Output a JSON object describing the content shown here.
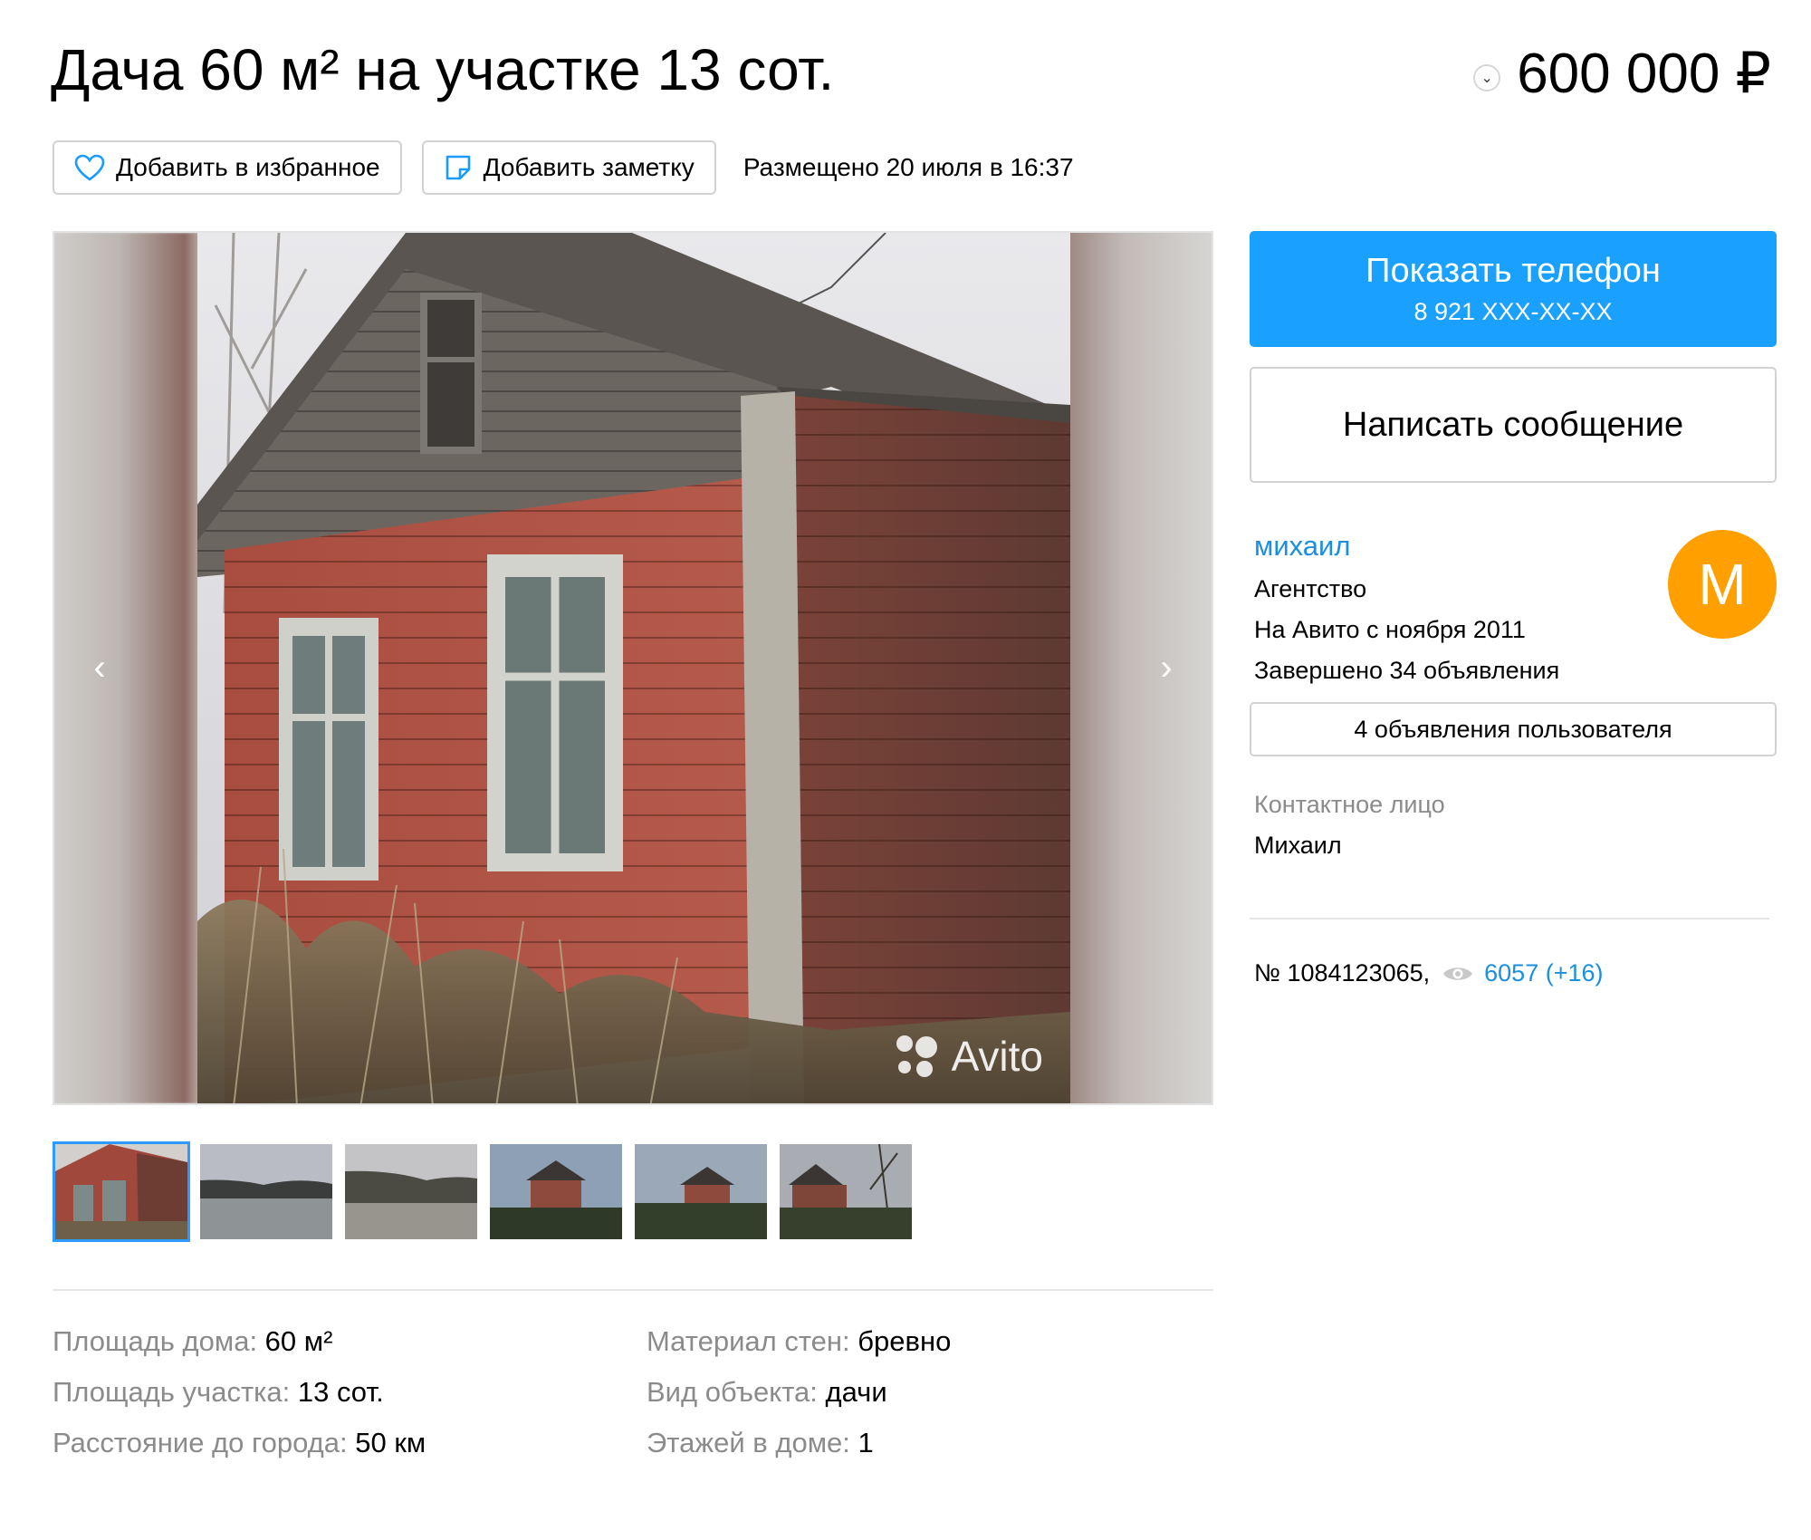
{
  "listing": {
    "title": "Дача 60 м² на участке 13 сот.",
    "price": "600 000 ₽",
    "posted": "Размещено 20 июля в 16:37"
  },
  "actions": {
    "favorite_label": "Добавить в избранное",
    "note_label": "Добавить заметку"
  },
  "gallery": {
    "watermark": "Avito",
    "thumbnails": [
      "house-front",
      "lake-shore",
      "lake-shore-2",
      "house-distant",
      "house-field",
      "house-trees"
    ],
    "active_thumbnail": 0
  },
  "params": [
    {
      "key": "Площадь дома: ",
      "value": "60 м²"
    },
    {
      "key": "Материал стен: ",
      "value": "бревно"
    },
    {
      "key": "Площадь участка: ",
      "value": "13 сот."
    },
    {
      "key": "Вид объекта: ",
      "value": "дачи"
    },
    {
      "key": "Расстояние до города: ",
      "value": "50 км"
    },
    {
      "key": "Этажей в доме: ",
      "value": "1"
    }
  ],
  "sidebar": {
    "show_phone_label": "Показать телефон",
    "phone_masked": "8 921 XXX-XX-XX",
    "message_label": "Написать сообщение",
    "seller": {
      "name": "михаил",
      "type": "Агентство",
      "since": "На Авито с ноября 2011",
      "completed": "Завершено 34 объявления",
      "avatar_letter": "M",
      "avatar_color": "#ff9f00"
    },
    "user_ads_label": "4 объявления пользователя",
    "contact_label": "Контактное лицо",
    "contact_name": "Михаил",
    "listing_number": "№ 1084123065,",
    "views": "6057 (+16)"
  },
  "colors": {
    "accent": "#1aa0ff",
    "link": "#1a8fdf",
    "muted": "#8b8b8b"
  }
}
